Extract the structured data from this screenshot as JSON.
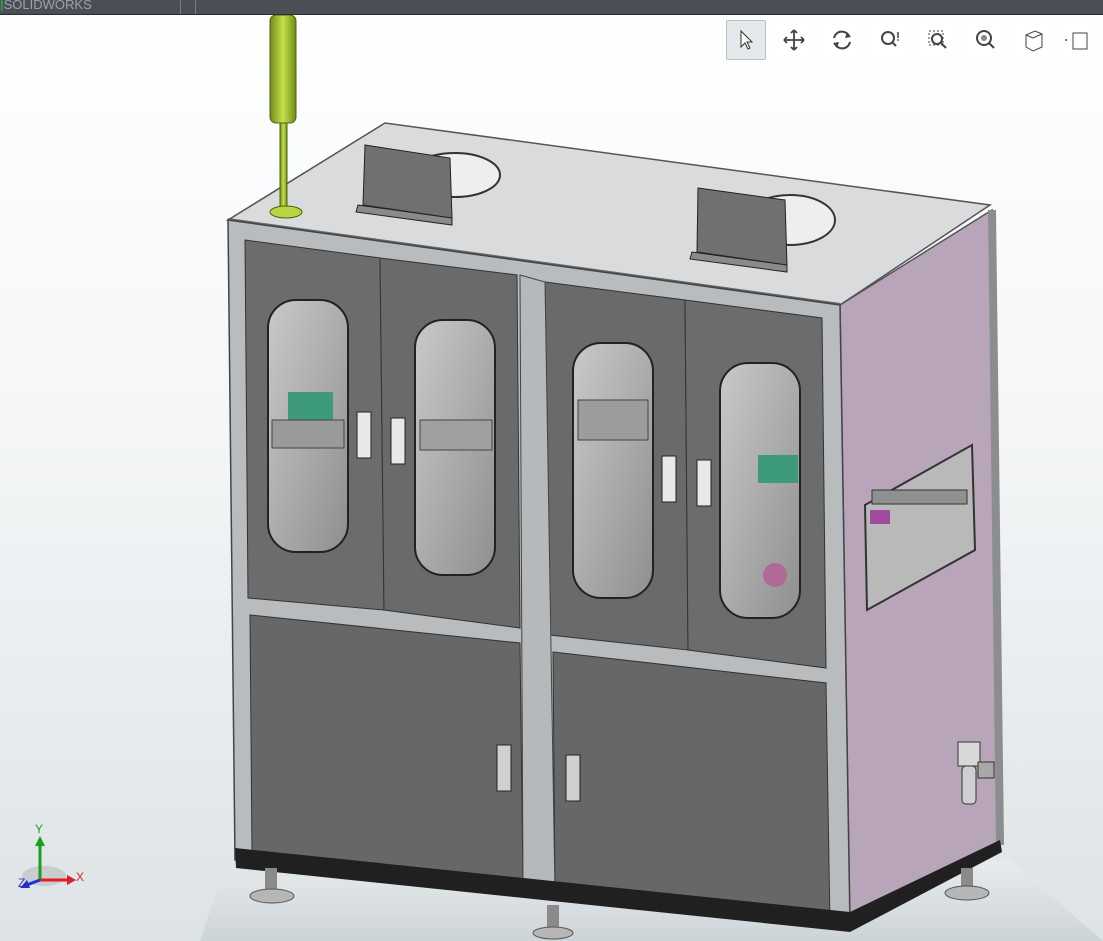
{
  "app": {
    "logo_text": "SOLIDWORKS"
  },
  "toolbar": {
    "tools": [
      {
        "name": "select-tool",
        "icon": "cursor-arrow-icon",
        "active": true
      },
      {
        "name": "pan-tool",
        "icon": "pan-arrows-icon",
        "active": false
      },
      {
        "name": "rotate-tool",
        "icon": "rotate-view-icon",
        "active": false
      },
      {
        "name": "zoom-in-out-tool",
        "icon": "zoom-in-out-icon",
        "active": false
      },
      {
        "name": "zoom-to-area-tool",
        "icon": "zoom-to-area-icon",
        "active": false
      },
      {
        "name": "zoom-to-fit-tool",
        "icon": "zoom-to-fit-icon",
        "active": false
      },
      {
        "name": "view-orientation-tool",
        "icon": "view-cube-icon",
        "active": false
      },
      {
        "name": "display-style-tool",
        "icon": "display-style-icon",
        "active": false
      }
    ]
  },
  "triad": {
    "x_label": "X",
    "y_label": "Y",
    "z_label": "Z"
  },
  "colors": {
    "frame": "#b9bdbf",
    "panel": "#6a6a6a",
    "side_panel": "#b7a3b8",
    "top_panel": "#d4d6d7",
    "selected_part": "#a6c635",
    "axis_x": "#e02020",
    "axis_y": "#1aa01a",
    "axis_z": "#2030d0"
  }
}
